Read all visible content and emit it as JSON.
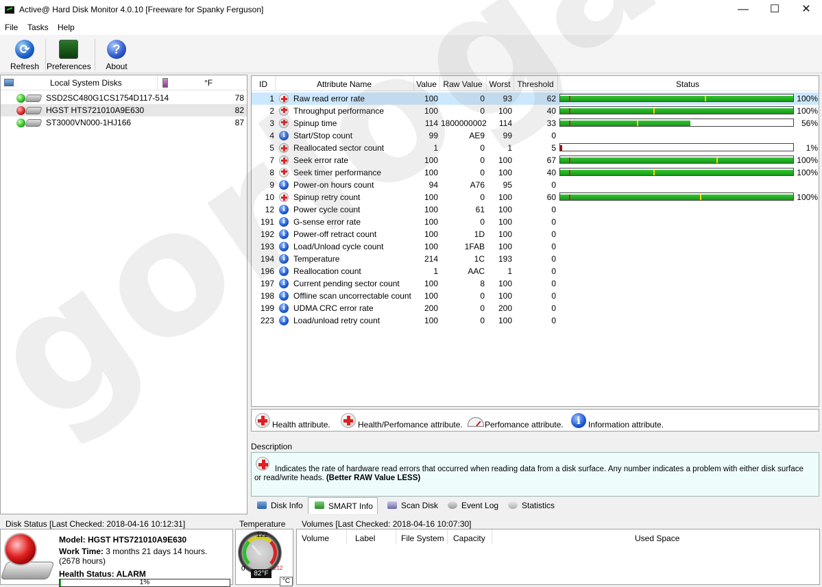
{
  "window": {
    "title": "Active@ Hard Disk Monitor 4.0.10 [Freeware for Spanky Ferguson]",
    "minimize": "—",
    "maximize": "☐",
    "close": "✕"
  },
  "menu": [
    "File",
    "Tasks",
    "Help"
  ],
  "toolbar": {
    "refresh": "Refresh",
    "preferences": "Preferences",
    "about": "About"
  },
  "disks_panel": {
    "header": "Local System Disks",
    "unit": "°F",
    "disks": [
      {
        "name": "SSD2SC480G1CS1754D117-514",
        "temp": "78",
        "status": "ok"
      },
      {
        "name": "HGST HTS721010A9E630",
        "temp": "82",
        "status": "alarm"
      },
      {
        "name": "ST3000VN000-1HJ166",
        "temp": "87",
        "status": "ok"
      }
    ]
  },
  "smart_table": {
    "columns": [
      "ID",
      "Attribute Name",
      "Value",
      "Raw Value",
      "Worst",
      "Threshold",
      "Status"
    ],
    "rows": [
      {
        "id": "1",
        "type": "health",
        "name": "Raw read error rate",
        "value": "100",
        "raw": "0",
        "worst": "93",
        "threshold": "62",
        "pct": "100%",
        "fill": 100,
        "marker": 62
      },
      {
        "id": "2",
        "type": "hp",
        "name": "Throughput performance",
        "value": "100",
        "raw": "0",
        "worst": "100",
        "threshold": "40",
        "pct": "100%",
        "fill": 100,
        "marker": 40
      },
      {
        "id": "3",
        "type": "hp",
        "name": "Spinup time",
        "value": "114",
        "raw": "1800000002",
        "worst": "114",
        "threshold": "33",
        "pct": "56%",
        "fill": 56,
        "marker": 33
      },
      {
        "id": "4",
        "type": "info",
        "name": "Start/Stop count",
        "value": "99",
        "raw": "AE9",
        "worst": "99",
        "threshold": "0",
        "pct": "",
        "fill": null,
        "marker": null
      },
      {
        "id": "5",
        "type": "health",
        "name": "Reallocated sector count",
        "value": "1",
        "raw": "0",
        "worst": "1",
        "threshold": "5",
        "pct": "1%",
        "fill": 1,
        "marker": null
      },
      {
        "id": "7",
        "type": "health",
        "name": "Seek error rate",
        "value": "100",
        "raw": "0",
        "worst": "100",
        "threshold": "67",
        "pct": "100%",
        "fill": 100,
        "marker": 67
      },
      {
        "id": "8",
        "type": "hp",
        "name": "Seek timer performance",
        "value": "100",
        "raw": "0",
        "worst": "100",
        "threshold": "40",
        "pct": "100%",
        "fill": 100,
        "marker": 40
      },
      {
        "id": "9",
        "type": "info",
        "name": "Power-on hours count",
        "value": "94",
        "raw": "A76",
        "worst": "95",
        "threshold": "0",
        "pct": "",
        "fill": null,
        "marker": null
      },
      {
        "id": "10",
        "type": "health",
        "name": "Spinup retry count",
        "value": "100",
        "raw": "0",
        "worst": "100",
        "threshold": "60",
        "pct": "100%",
        "fill": 100,
        "marker": 60
      },
      {
        "id": "12",
        "type": "info",
        "name": "Power cycle count",
        "value": "100",
        "raw": "61",
        "worst": "100",
        "threshold": "0",
        "pct": "",
        "fill": null,
        "marker": null
      },
      {
        "id": "191",
        "type": "info",
        "name": "G-sense error rate",
        "value": "100",
        "raw": "0",
        "worst": "100",
        "threshold": "0",
        "pct": "",
        "fill": null,
        "marker": null
      },
      {
        "id": "192",
        "type": "info",
        "name": "Power-off retract count",
        "value": "100",
        "raw": "1D",
        "worst": "100",
        "threshold": "0",
        "pct": "",
        "fill": null,
        "marker": null
      },
      {
        "id": "193",
        "type": "info",
        "name": "Load/Unload cycle count",
        "value": "100",
        "raw": "1FAB",
        "worst": "100",
        "threshold": "0",
        "pct": "",
        "fill": null,
        "marker": null
      },
      {
        "id": "194",
        "type": "info",
        "name": "Temperature",
        "value": "214",
        "raw": "1C",
        "worst": "193",
        "threshold": "0",
        "pct": "",
        "fill": null,
        "marker": null
      },
      {
        "id": "196",
        "type": "info",
        "name": "Reallocation count",
        "value": "1",
        "raw": "AAC",
        "worst": "1",
        "threshold": "0",
        "pct": "",
        "fill": null,
        "marker": null
      },
      {
        "id": "197",
        "type": "info",
        "name": "Current pending sector count",
        "value": "100",
        "raw": "8",
        "worst": "100",
        "threshold": "0",
        "pct": "",
        "fill": null,
        "marker": null
      },
      {
        "id": "198",
        "type": "info",
        "name": "Offline scan uncorrectable count",
        "value": "100",
        "raw": "0",
        "worst": "100",
        "threshold": "0",
        "pct": "",
        "fill": null,
        "marker": null
      },
      {
        "id": "199",
        "type": "info",
        "name": "UDMA CRC error rate",
        "value": "200",
        "raw": "0",
        "worst": "200",
        "threshold": "0",
        "pct": "",
        "fill": null,
        "marker": null
      },
      {
        "id": "223",
        "type": "info",
        "name": "Load/unload retry count",
        "value": "100",
        "raw": "0",
        "worst": "100",
        "threshold": "0",
        "pct": "",
        "fill": null,
        "marker": null
      }
    ]
  },
  "legend": {
    "health": "Health attribute.",
    "health_perf": "Health/Perfomance attribute.",
    "perf": "Perfomance attribute.",
    "info": "Information attribute."
  },
  "description": {
    "label": "Description",
    "text": "Indicates the rate of hardware read errors that occurred when reading data from a disk surface. Any number indicates a problem with either disk surface or read/write heads.",
    "emphasis": "(Better RAW Value LESS)"
  },
  "tabs": [
    "Disk Info",
    "SMART Info",
    "Scan Disk",
    "Event Log",
    "Statistics"
  ],
  "disk_status": {
    "title": "Disk Status [Last Checked: 2018-04-16 10:12:31]",
    "model_label": "Model:",
    "model": "HGST HTS721010A9E630",
    "work_label": "Work Time:",
    "work_time": "3 months 21 days 14 hours. (2678 hours)",
    "health_label": "Health Status:",
    "health": "ALARM",
    "health_pct_text": "1%",
    "health_pct": 1
  },
  "temperature": {
    "title": "Temperature",
    "gauge_top": "122",
    "gauge_min": "0",
    "gauge_max": "212",
    "reading": "82°F",
    "unit_button": "°C"
  },
  "volumes": {
    "title": "Volumes [Last Checked: 2018-04-16 10:07:30]",
    "columns": [
      "Volume",
      "Label",
      "File System",
      "Capacity",
      "Used Space"
    ]
  },
  "watermark": "gorlogato"
}
